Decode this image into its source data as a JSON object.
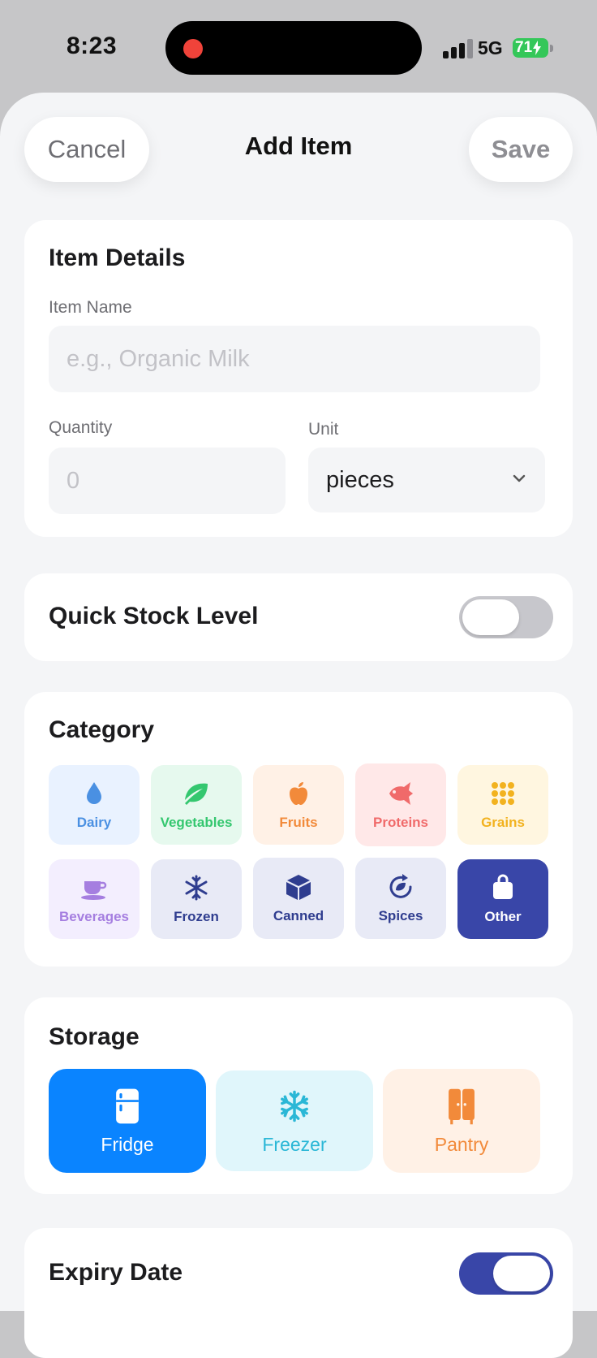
{
  "status": {
    "time": "8:23",
    "network": "5G",
    "battery": "71"
  },
  "nav": {
    "cancel": "Cancel",
    "title": "Add Item",
    "save": "Save"
  },
  "details": {
    "title": "Item Details",
    "name_label": "Item Name",
    "name_placeholder": "e.g., Organic Milk",
    "quantity_label": "Quantity",
    "quantity_placeholder": "0",
    "unit_label": "Unit",
    "unit_value": "pieces"
  },
  "stock": {
    "title": "Quick Stock Level",
    "enabled": false
  },
  "category": {
    "title": "Category",
    "selected": "Other",
    "items": [
      {
        "label": "Dairy",
        "icon": "drop-icon",
        "bg": "#e9f2ff",
        "fg": "#4a90e2"
      },
      {
        "label": "Vegetables",
        "icon": "leaf-icon",
        "bg": "#e6f9ee",
        "fg": "#34c76f"
      },
      {
        "label": "Fruits",
        "icon": "apple-icon",
        "bg": "#fff1e6",
        "fg": "#f28a3a"
      },
      {
        "label": "Proteins",
        "icon": "fish-icon",
        "bg": "#ffe8e8",
        "fg": "#f06a6a"
      },
      {
        "label": "Grains",
        "icon": "grid-dots-icon",
        "bg": "#fff6e0",
        "fg": "#f2b21f"
      },
      {
        "label": "Beverages",
        "icon": "cup-icon",
        "bg": "#f3eefe",
        "fg": "#a57ee0"
      },
      {
        "label": "Frozen",
        "icon": "snowflake-icon",
        "bg": "#e8eaf6",
        "fg": "#2f3d8f"
      },
      {
        "label": "Canned",
        "icon": "box-icon",
        "bg": "#e8eaf6",
        "fg": "#2f3d8f"
      },
      {
        "label": "Spices",
        "icon": "refresh-leaf-icon",
        "bg": "#e8eaf6",
        "fg": "#2f3d8f"
      },
      {
        "label": "Other",
        "icon": "bag-icon",
        "bg": "#3946a8",
        "fg": "#ffffff"
      }
    ]
  },
  "storage": {
    "title": "Storage",
    "selected": "Fridge",
    "items": [
      {
        "label": "Fridge",
        "icon": "fridge-icon",
        "bg": "#0a84ff",
        "fg": "#ffffff"
      },
      {
        "label": "Freezer",
        "icon": "snowflake-icon",
        "bg": "#e0f6fb",
        "fg": "#2ab7d6"
      },
      {
        "label": "Pantry",
        "icon": "cabinet-icon",
        "bg": "#fff1e6",
        "fg": "#f28a3a"
      }
    ]
  },
  "expiry": {
    "title": "Expiry Date",
    "enabled": true
  }
}
